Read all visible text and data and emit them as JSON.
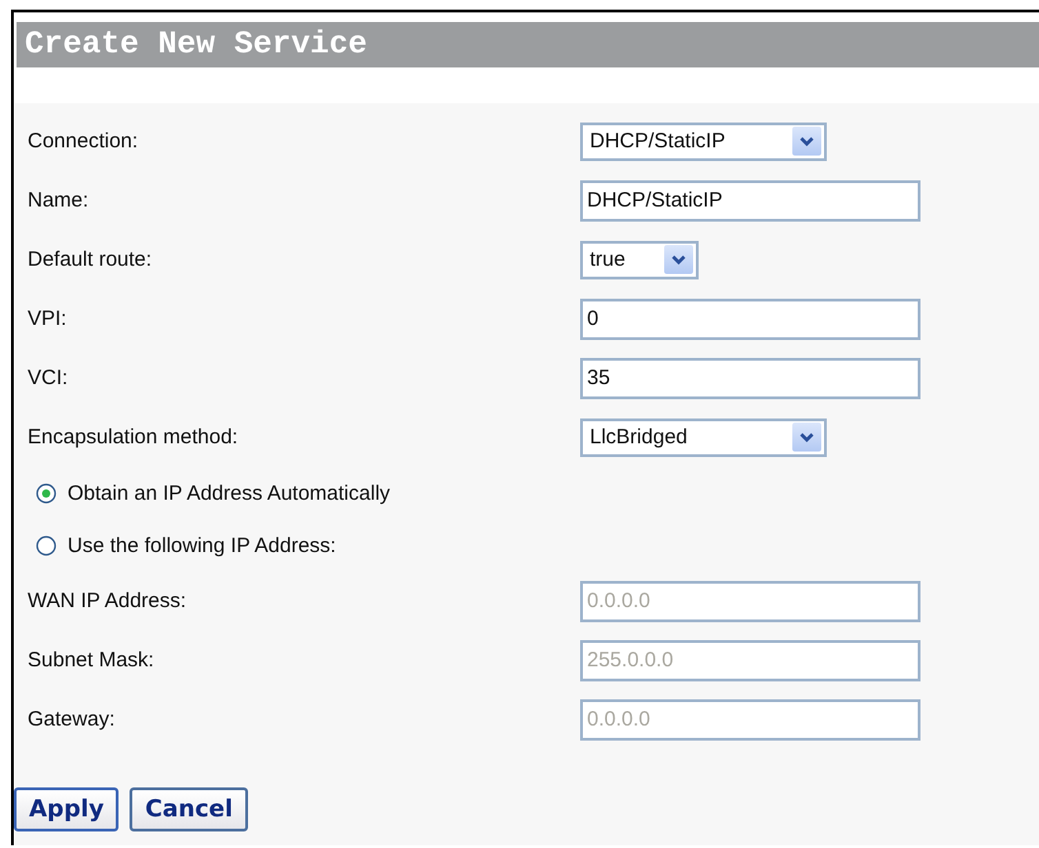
{
  "title": "Create New Service",
  "fields": [
    {
      "kind": "select",
      "label": "Connection:",
      "value": "DHCP/StaticIP"
    },
    {
      "kind": "text",
      "label": "Name:",
      "value": "DHCP/StaticIP",
      "disabled": false
    },
    {
      "kind": "select",
      "label": "Default route:",
      "value": "true"
    },
    {
      "kind": "text",
      "label": "VPI:",
      "value": "0",
      "disabled": false
    },
    {
      "kind": "text",
      "label": "VCI:",
      "value": "35",
      "disabled": false
    },
    {
      "kind": "select",
      "label": "Encapsulation method:",
      "value": "LlcBridged"
    },
    {
      "kind": "radio",
      "label": "Obtain an IP Address Automatically",
      "selected": true
    },
    {
      "kind": "radio",
      "label": "Use the following IP Address:",
      "selected": false
    },
    {
      "kind": "text",
      "label": "WAN IP Address:",
      "value": "0.0.0.0",
      "disabled": true
    },
    {
      "kind": "text",
      "label": "Subnet Mask:",
      "value": "255.0.0.0",
      "disabled": true
    },
    {
      "kind": "text",
      "label": "Gateway:",
      "value": "0.0.0.0",
      "disabled": true
    }
  ],
  "buttons": [
    "Apply",
    "Cancel"
  ]
}
